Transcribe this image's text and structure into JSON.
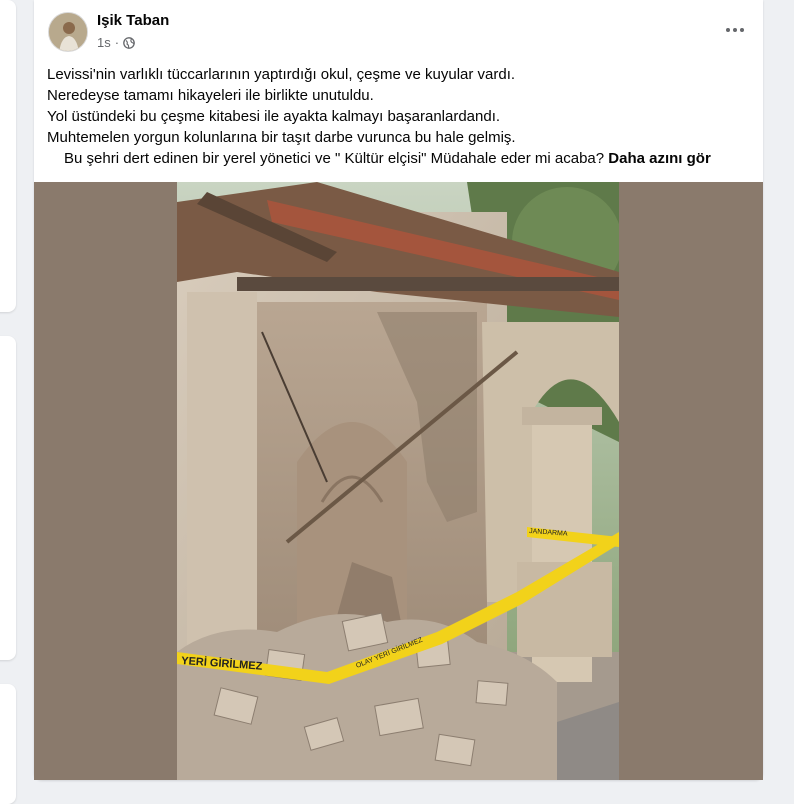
{
  "post": {
    "author": "Işik Taban",
    "time": "1s",
    "separator": "·",
    "privacy_icon": "globe-icon",
    "more_icon": "more-options-icon",
    "lines": [
      "Levissi'nin varlıklı tüccarlarının yaptırdığı okul, çeşme ve kuyular vardı.",
      "Neredeyse tamamı hikayeleri ile birlikte unutuldu.",
      "Yol üstündeki bu çeşme kitabesi ile ayakta kalmayı başaranlardandı.",
      "Muhtemelen yorgun kolunlarına bir taşıt darbe vurunca bu hale gelmiş."
    ],
    "last_line": "Bu şehri dert edinen bir yerel yönetici ve \" Kültür elçisi\" Müdahale eder mi acaba?",
    "see_more": "Daha azını gör",
    "photo": {
      "tape_text": "YERİ GİRİLMEZ",
      "tape_text_2": "JANDARMA",
      "tape_text_3": "OLAY YERİ GİRİLMEZ"
    }
  },
  "colors": {
    "background": "#eef0f3",
    "card": "#ffffff",
    "text": "#050505",
    "secondary": "#65676b",
    "media_bg": "#8a7a6c",
    "tape": "#f2d21a"
  }
}
